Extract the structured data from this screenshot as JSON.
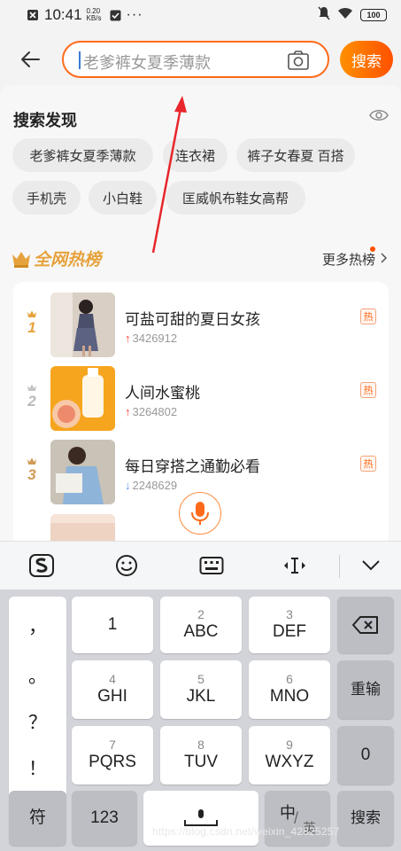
{
  "status_bar": {
    "time": "10:41",
    "net_speed": "0.20 KB/s",
    "battery": "100"
  },
  "search": {
    "placeholder": "老爹裤女夏季薄款",
    "button_label": "搜索"
  },
  "discovery": {
    "title": "搜索发现",
    "chips": [
      "老爹裤女夏季薄款",
      "连衣裙",
      "裤子女春夏 百搭",
      "手机壳",
      "小白鞋",
      "匡威帆布鞋女高帮"
    ]
  },
  "hot_list": {
    "title": "全网热榜",
    "more_label": "更多热榜",
    "items": [
      {
        "rank": "1",
        "title": "可盐可甜的夏日女孩",
        "count": "3426912",
        "trend": "up",
        "badge": "热"
      },
      {
        "rank": "2",
        "title": "人间水蜜桃",
        "count": "3264802",
        "trend": "up",
        "badge": "热"
      },
      {
        "rank": "3",
        "title": "每日穿搭之通勤必看",
        "count": "2248629",
        "trend": "down",
        "badge": "热"
      }
    ]
  },
  "keyboard": {
    "punctuation": [
      "，",
      "。",
      "？",
      "！"
    ],
    "keys": [
      {
        "sub": "",
        "main": "1"
      },
      {
        "sub": "2",
        "main": "ABC"
      },
      {
        "sub": "3",
        "main": "DEF"
      },
      {
        "sub": "4",
        "main": "GHI"
      },
      {
        "sub": "5",
        "main": "JKL"
      },
      {
        "sub": "6",
        "main": "MNO"
      },
      {
        "sub": "7",
        "main": "PQRS"
      },
      {
        "sub": "8",
        "main": "TUV"
      },
      {
        "sub": "9",
        "main": "WXYZ"
      }
    ],
    "reinput": "重输",
    "zero": "0",
    "symbols": "符",
    "num123": "123",
    "lang_zh": "中",
    "lang_en": "英",
    "search": "搜索"
  },
  "watermark": "https://blog.csdn.net/weixin_42825257",
  "colors": {
    "accent": "#ff5000",
    "gold": "#e6a23c"
  }
}
